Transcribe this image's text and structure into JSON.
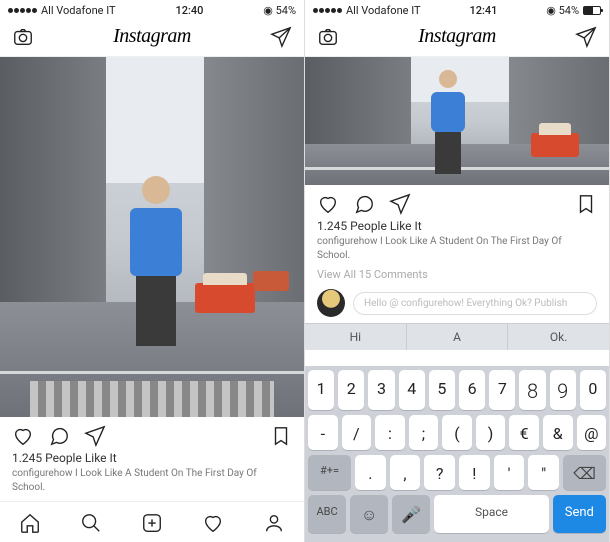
{
  "left": {
    "status": {
      "carrier": "All Vodafone IT",
      "time": "12:40",
      "battery": "54%"
    },
    "header": {
      "logo": "Instagram"
    },
    "post": {
      "likes": "1.245 People Like It",
      "caption_user": "configurehow",
      "caption_rest": " I Look Like A Student On The First Day Of School."
    }
  },
  "right": {
    "status": {
      "carrier": "All Vodafone IT",
      "time": "12:41",
      "battery": "54%"
    },
    "header": {
      "logo": "Instagram"
    },
    "post": {
      "likes": "1.245 People Like It",
      "caption_user": "configurehow",
      "caption_rest": " I Look Like A Student On The First Day Of School.",
      "view_comments": "View All 15 Comments",
      "comment_placeholder": "Hello @ configurehow! Everything Ok? Publish"
    },
    "kb": {
      "suggest": [
        "Hi",
        "A",
        "Ok."
      ],
      "row1": [
        "1",
        "2",
        "3",
        "4",
        "5",
        "6",
        "7",
        "8",
        "9",
        "0"
      ],
      "row2": [
        "-",
        "/",
        ":",
        ";",
        "(",
        ")",
        "€",
        "&",
        "@"
      ],
      "row3_sym": "#+=",
      "row3": [
        ".",
        ",",
        "?",
        "!",
        "'",
        "\""
      ],
      "row3_del": "⌫",
      "abc": "ABC",
      "emoji": "☺",
      "mic": "🎤",
      "space": "Space",
      "send": "Send"
    }
  }
}
